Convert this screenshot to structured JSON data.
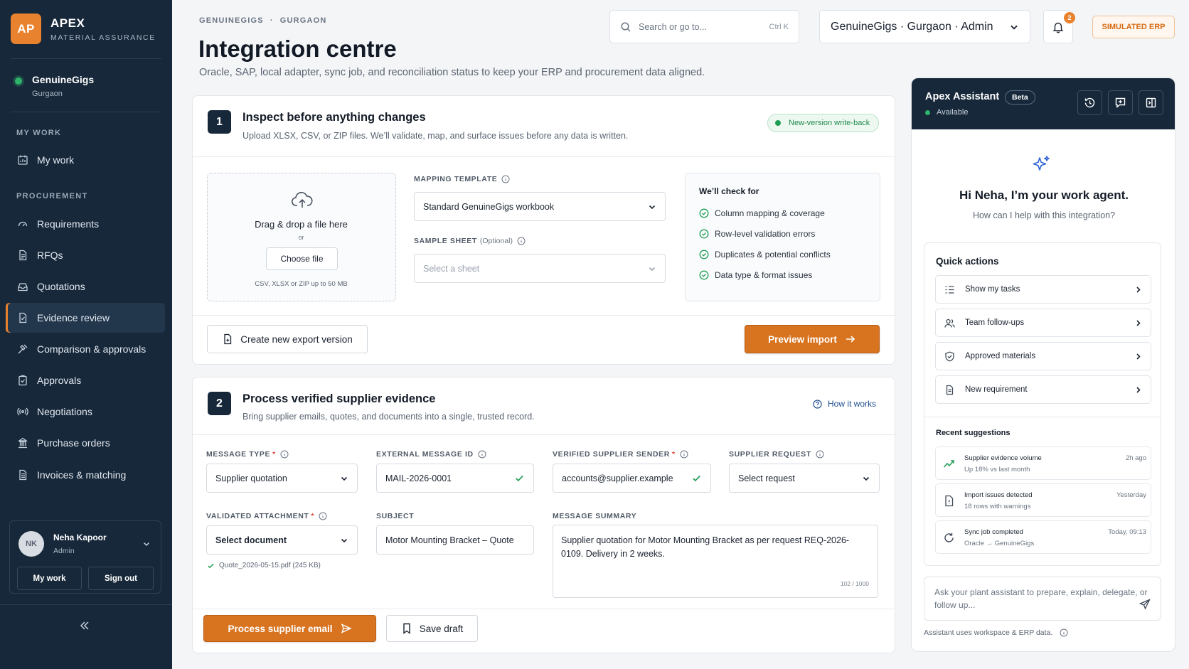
{
  "brand": {
    "logo": "AP",
    "name": "APEX",
    "subtitle": "MATERIAL ASSURANCE"
  },
  "org": {
    "name": "GenuineGigs",
    "location": "Gurgaon",
    "status_color": "#2fb36a"
  },
  "sidebar": {
    "my_work_title": "MY WORK",
    "procurement_title": "PROCUREMENT",
    "items": [
      {
        "label": "My work",
        "icon": "calendar-chart-icon"
      },
      {
        "label": "Requirements",
        "icon": "gauge-icon"
      },
      {
        "label": "RFQs",
        "icon": "document-icon"
      },
      {
        "label": "Quotations",
        "icon": "inbox-icon"
      },
      {
        "label": "Evidence review",
        "icon": "document-check-icon",
        "active": true
      },
      {
        "label": "Comparison & approvals",
        "icon": "hammer-icon"
      },
      {
        "label": "Approvals",
        "icon": "clipboard-check-icon"
      },
      {
        "label": "Negotiations",
        "icon": "broadcast-icon"
      },
      {
        "label": "Purchase orders",
        "icon": "building-icon"
      },
      {
        "label": "Invoices & matching",
        "icon": "invoice-icon"
      }
    ]
  },
  "user": {
    "initials": "NK",
    "name": "Neha Kapoor",
    "role": "Admin",
    "my_work": "My work",
    "sign_out": "Sign out"
  },
  "header": {
    "breadcrumb": [
      "GENUINEGIGS",
      "·",
      "GURGAON"
    ],
    "title": "Integration centre",
    "description": "Oracle, SAP, local adapter, sync job, and reconciliation status to keep your ERP and procurement data aligned.",
    "search_placeholder": "Search or go to...",
    "search_shortcut": "Ctrl K",
    "org_selector": "GenuineGigs · Gurgaon · Admin",
    "notification_count": "2",
    "simulated": "SIMULATED ERP"
  },
  "inspect": {
    "step": "1",
    "title": "Inspect before anything changes",
    "subtitle": "Upload XLSX, CSV, or ZIP files. We’ll validate, map, and surface issues before any data is written.",
    "badge": "New-version write-back",
    "drop_title": "Drag & drop a file here",
    "drop_or": "or",
    "choose_file": "Choose file",
    "drop_hint": "CSV, XLSX or ZIP up to 50 MB",
    "mapping_label": "MAPPING TEMPLATE",
    "mapping_value": "Standard GenuineGigs workbook",
    "sheet_label": "SAMPLE SHEET",
    "sheet_optional": "(Optional)",
    "sheet_placeholder": "Select a sheet",
    "checks_title": "We’ll check for",
    "checks": [
      "Column mapping & coverage",
      "Row-level validation errors",
      "Duplicates & potential conflicts",
      "Data type & format issues"
    ],
    "export_button": "Create new export version",
    "preview_button": "Preview import"
  },
  "process": {
    "step": "2",
    "title": "Process verified supplier evidence",
    "subtitle": "Bring supplier emails, quotes, and documents into a single, trusted record.",
    "how_it_works": "How it works",
    "message_type_label": "MESSAGE TYPE",
    "message_type_value": "Supplier quotation",
    "external_id_label": "EXTERNAL MESSAGE ID",
    "external_id_value": "MAIL-2026-0001",
    "sender_label": "VERIFIED SUPPLIER SENDER",
    "sender_value": "accounts@supplier.example",
    "request_label": "SUPPLIER REQUEST",
    "request_value": "Select request",
    "attachment_label": "VALIDATED ATTACHMENT",
    "attachment_value": "Select document",
    "attachment_file": "Quote_2026-05-15.pdf (245 KB)",
    "subject_label": "SUBJECT",
    "subject_value": "Motor Mounting Bracket – Quote",
    "summary_label": "MESSAGE SUMMARY",
    "summary_value": "Supplier quotation for Motor Mounting Bracket as per request REQ-2026-0109. Delivery in 2 weeks.",
    "summary_count": "102 / 1000",
    "process_button": "Process supplier email",
    "save_button": "Save draft"
  },
  "assistant": {
    "title": "Apex Assistant",
    "beta": "Beta",
    "status": "Available",
    "greeting": "Hi Neha, I’m your work agent.",
    "help": "How can I help with this integration?",
    "quick_title": "Quick actions",
    "quick_actions": [
      {
        "label": "Show my tasks",
        "icon": "list-icon"
      },
      {
        "label": "Team follow-ups",
        "icon": "users-icon"
      },
      {
        "label": "Approved materials",
        "icon": "shield-check-icon"
      },
      {
        "label": "New requirement",
        "icon": "document-icon"
      }
    ],
    "recent_title": "Recent suggestions",
    "recent": [
      {
        "title": "Supplier evidence volume",
        "sub": "Up 18% vs last month",
        "time": "2h ago",
        "icon": "trend-up-icon"
      },
      {
        "title": "Import issues detected",
        "sub": "18 rows with warnings",
        "time": "Yesterday",
        "icon": "document-alert-icon"
      },
      {
        "title": "Sync job completed",
        "sub": "Oracle → GenuineGigs",
        "time": "Today, 09:13",
        "icon": "sync-icon"
      }
    ],
    "ask_placeholder": "Ask your plant assistant to prepare, explain, delegate, or follow up...",
    "footer": "Assistant uses workspace & ERP data."
  },
  "colors": {
    "accent": "#d8731f",
    "navy": "#17283a",
    "success": "#1f9d55",
    "link": "#1f4f8f"
  }
}
